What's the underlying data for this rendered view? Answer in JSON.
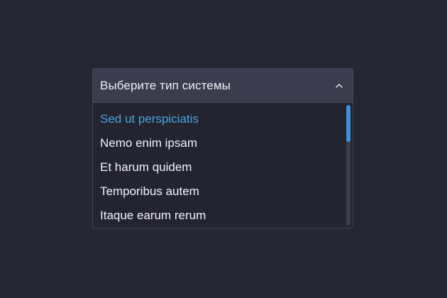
{
  "select": {
    "value": "Выберите тип системы",
    "expanded_icon": "chevron-up-icon",
    "options": [
      {
        "label": "Sed ut perspiciatis",
        "selected": true
      },
      {
        "label": "Nemo enim ipsam",
        "selected": false
      },
      {
        "label": "Et harum quidem",
        "selected": false
      },
      {
        "label": "Temporibus autem",
        "selected": false
      },
      {
        "label": "Itaque earum rerum",
        "selected": false
      }
    ],
    "scroll_position": 0
  },
  "colors": {
    "background": "#252631",
    "header_bg": "#3b3d4e",
    "list_bg": "#232430",
    "text": "#f1f2f6",
    "accent": "#4aa3df",
    "scroll_thumb": "#3d8fd8"
  }
}
